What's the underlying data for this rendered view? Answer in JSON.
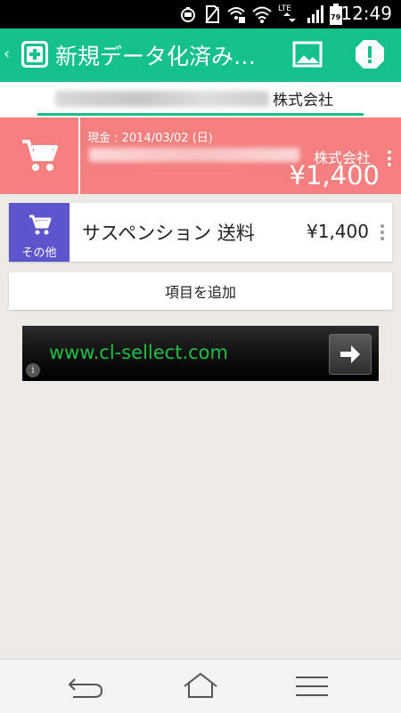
{
  "status_bar": {
    "network_label": "LTE",
    "battery_level": "79",
    "time": "12:49"
  },
  "app_bar": {
    "back_symbol": "‹",
    "title": "新規データ化済み…",
    "actions": [
      "image-icon",
      "alert-icon"
    ]
  },
  "tabs": {
    "active_label": "株式会社"
  },
  "summary": {
    "meta": "現金 : 2014/03/02 (日)",
    "company": "株式会社",
    "amount": "¥1,400",
    "icon": "shopping-cart-icon"
  },
  "items": [
    {
      "category_label": "その他",
      "name": "サスペンション 送料",
      "amount": "¥1,400",
      "icon": "shopping-cart-icon"
    }
  ],
  "add_item_label": "項目を追加",
  "ad": {
    "url_text": "www.cl-sellect.com",
    "info_symbol": "i"
  },
  "nav": [
    "back-icon",
    "home-icon",
    "menu-icon"
  ],
  "colors": {
    "accent": "#14c08c",
    "summary_bg": "#f47f7f",
    "category_bg": "#5d55cc",
    "ad_text": "#1fbf44"
  }
}
